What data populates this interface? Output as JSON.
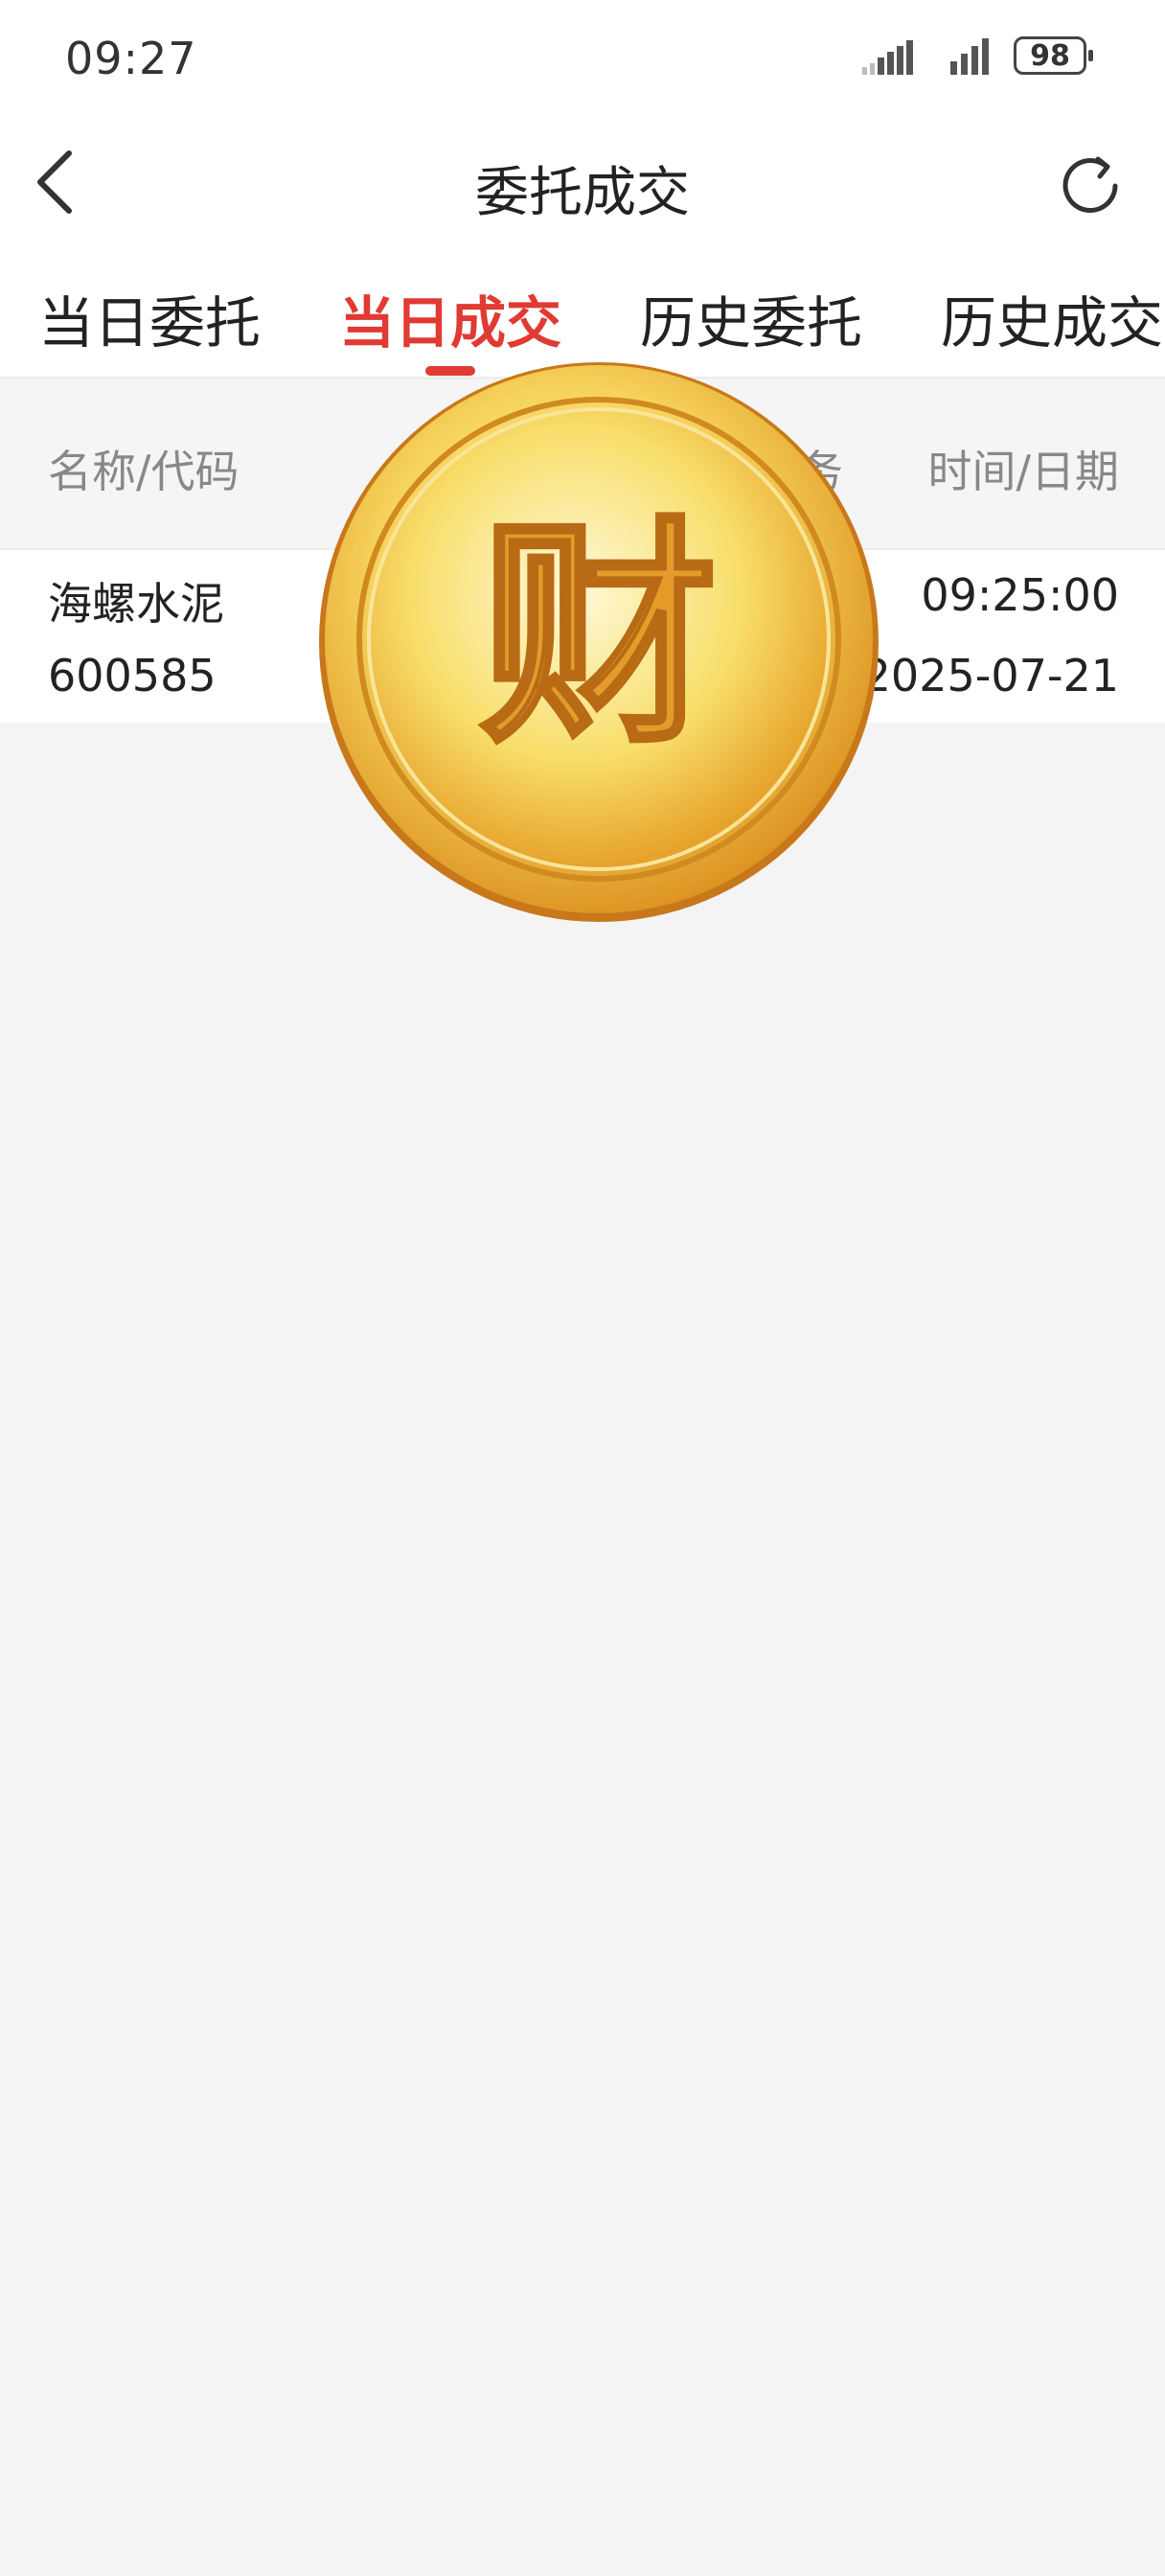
{
  "status_bar": {
    "time": "09:27",
    "battery": "98"
  },
  "nav": {
    "title": "委托成交"
  },
  "tabs": [
    {
      "label": "当日委托",
      "active": false
    },
    {
      "label": "当日成交",
      "active": true
    },
    {
      "label": "历史委托",
      "active": false
    },
    {
      "label": "历史成交",
      "active": false
    }
  ],
  "table": {
    "headers": {
      "name_code": "名称/代码",
      "partial_hidden": "务",
      "time_date": "时间/日期"
    },
    "rows": [
      {
        "name": "海螺水泥",
        "code": "600585",
        "time": "09:25:00",
        "date": "2025-07-21"
      }
    ]
  },
  "overlay": {
    "coin_glyph": "财"
  },
  "colors": {
    "accent": "#e03a32",
    "page_bg": "#f4f4f4",
    "coin_gold": "#f2b632"
  },
  "icons": {
    "back": "chevron-left-icon",
    "refresh": "refresh-icon",
    "signal": "signal-icon",
    "battery": "battery-icon"
  }
}
